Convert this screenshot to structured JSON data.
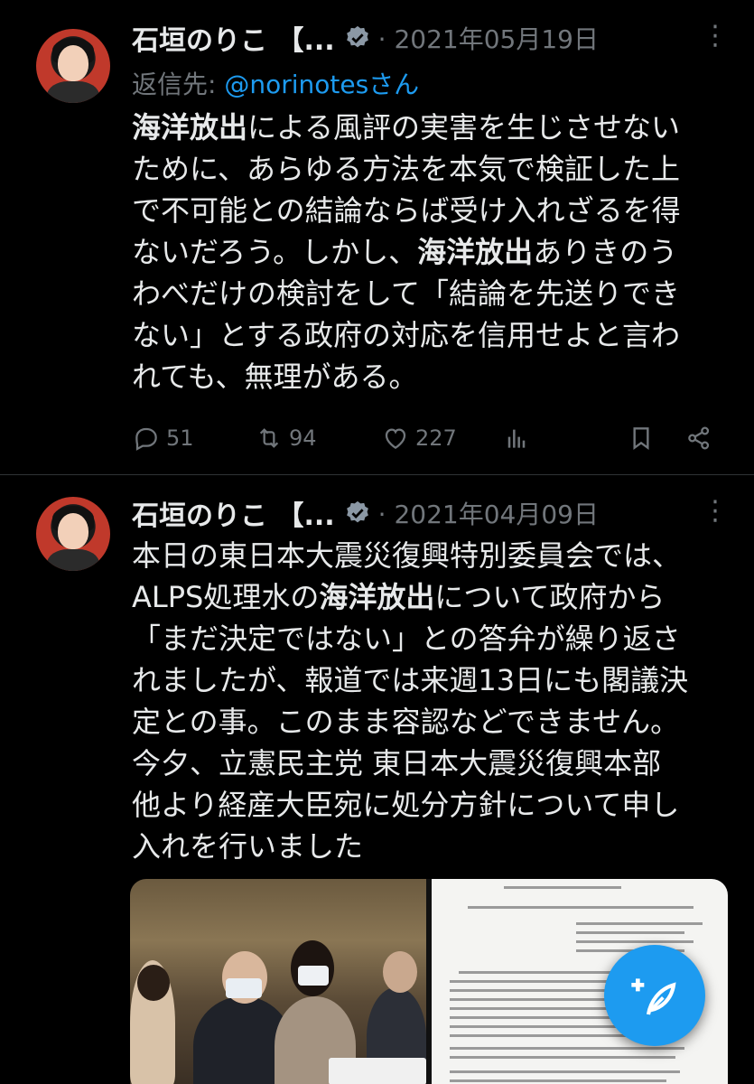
{
  "tweets": [
    {
      "author_name": "石垣のりこ 【...",
      "date": "· 2021年05月19日",
      "reply_prefix": "返信先: ",
      "reply_handle": "@norinotesさん",
      "body_lines": [
        [
          {
            "t": "海洋放出",
            "b": true
          },
          {
            "t": "による風評の実害を生じさせない",
            "b": false
          }
        ],
        [
          {
            "t": "ために、あらゆる方法を本気で検証した上",
            "b": false
          }
        ],
        [
          {
            "t": "で不可能との結論ならば受け入れざるを得",
            "b": false
          }
        ],
        [
          {
            "t": "ないだろう。しかし、",
            "b": false
          },
          {
            "t": "海洋放出",
            "b": true
          },
          {
            "t": "ありきのう",
            "b": false
          }
        ],
        [
          {
            "t": "わべだけの検討をして「結論を先送りでき",
            "b": false
          }
        ],
        [
          {
            "t": "ない」とする政府の対応を信用せよと言わ",
            "b": false
          }
        ],
        [
          {
            "t": "れても、無理がある。",
            "b": false
          }
        ]
      ],
      "replies": "51",
      "retweets": "94",
      "likes": "227"
    },
    {
      "author_name": "石垣のりこ 【...",
      "date": "· 2021年04月09日",
      "body_lines": [
        [
          {
            "t": "本日の東日本大震災復興特別委員会では、",
            "b": false
          }
        ],
        [
          {
            "t": "ALPS処理水の",
            "b": false
          },
          {
            "t": "海洋放出",
            "b": true
          },
          {
            "t": "について政府から",
            "b": false
          }
        ],
        [
          {
            "t": "「まだ決定ではない」との答弁が繰り返さ",
            "b": false
          }
        ],
        [
          {
            "t": "れましたが、報道では来週13日にも閣議決",
            "b": false
          }
        ],
        [
          {
            "t": "定との事。このまま容認などできません。",
            "b": false
          }
        ],
        [
          {
            "t": "今夕、立憲民主党 東日本大震災復興本部",
            "b": false
          }
        ],
        [
          {
            "t": "他より経産大臣宛に処分方針について申し",
            "b": false
          }
        ],
        [
          {
            "t": "入れを行いました",
            "b": false
          }
        ]
      ]
    }
  ],
  "icons": {
    "more": "more-icon",
    "reply": "reply-icon",
    "retweet": "retweet-icon",
    "like": "like-icon",
    "analytics": "analytics-icon",
    "bookmark": "bookmark-icon",
    "share": "share-icon",
    "verified": "verified-badge-icon",
    "compose": "compose-icon"
  },
  "colors": {
    "background": "#000000",
    "text": "#e7e9ea",
    "muted": "#71767b",
    "accent": "#1d9bf0"
  }
}
